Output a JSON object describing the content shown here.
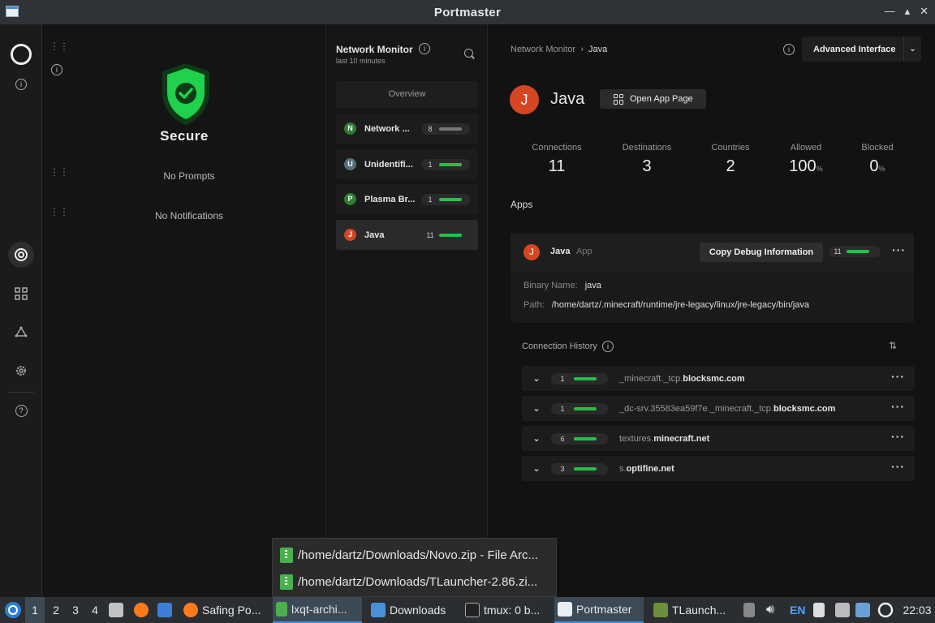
{
  "window": {
    "title": "Portmaster"
  },
  "dashboard": {
    "status": "Secure",
    "prompts": "No Prompts",
    "notifications": "No Notifications"
  },
  "network_monitor": {
    "title": "Network Monitor",
    "subtitle": "last 10 minutes",
    "info": "i",
    "overview": "Overview",
    "processes": [
      {
        "letter": "N",
        "name": "Network ...",
        "count": "8",
        "color": "#2e7d32",
        "bar": "#777777"
      },
      {
        "letter": "U",
        "name": "Unidentifi...",
        "count": "1",
        "color": "#546e7a",
        "bar": "#2bbd4a"
      },
      {
        "letter": "P",
        "name": "Plasma Br...",
        "count": "1",
        "color": "#2e7d32",
        "bar": "#2bbd4a"
      },
      {
        "letter": "J",
        "name": "Java",
        "count": "11",
        "color": "#d64524",
        "bar": "#2bbd4a"
      }
    ]
  },
  "main": {
    "breadcrumb_root": "Network Monitor",
    "breadcrumb_sep": "›",
    "breadcrumb_current": "Java",
    "advanced_interface": "Advanced Interface",
    "app_letter": "J",
    "app_name": "Java",
    "open_app_page": "Open App Page",
    "stats": {
      "connections_label": "Connections",
      "connections": "11",
      "destinations_label": "Destinations",
      "destinations": "3",
      "countries_label": "Countries",
      "countries": "2",
      "allowed_label": "Allowed",
      "allowed": "100",
      "allowed_unit": "%",
      "blocked_label": "Blocked",
      "blocked": "0",
      "blocked_unit": "%"
    },
    "apps_heading": "Apps",
    "app_card": {
      "name": "Java",
      "type": "App",
      "copy_debug": "Copy Debug Information",
      "count": "11",
      "binary_label": "Binary Name:",
      "binary_value": "java",
      "path_label": "Path:",
      "path_value": "/home/dartz/.minecraft/runtime/jre-legacy/linux/jre-legacy/bin/java"
    },
    "history_heading": "Connection History",
    "connections": [
      {
        "count": "1",
        "prefix": "_minecraft._tcp.",
        "domain": "blocksmc.com"
      },
      {
        "count": "1",
        "prefix": "_dc-srv.35583ea59f7e._minecraft._tcp.",
        "domain": "blocksmc.com"
      },
      {
        "count": "6",
        "prefix": "textures.",
        "domain": "minecraft.net"
      },
      {
        "count": "3",
        "prefix": "s.",
        "domain": "optifine.net"
      }
    ]
  },
  "popup": {
    "items": [
      "/home/dartz/Downloads/Novo.zip - File Arc...",
      "/home/dartz/Downloads/TLauncher-2.86.zi..."
    ]
  },
  "taskbar": {
    "workspaces": [
      "1",
      "2",
      "3",
      "4"
    ],
    "tasks": [
      "Safing Po...",
      "lxqt-archi...",
      "Downloads",
      "tmux: 0 b...",
      "Portmaster",
      "TLaunch..."
    ],
    "lang": "EN",
    "clock": "22:03"
  }
}
